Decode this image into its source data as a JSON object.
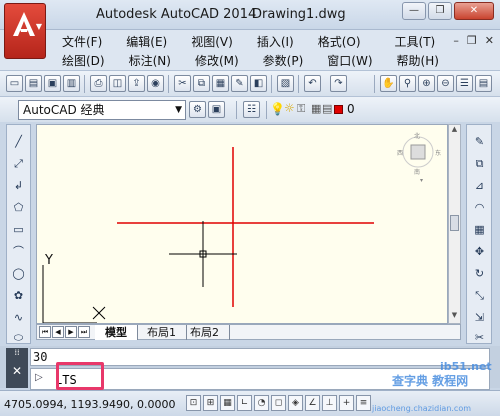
{
  "titlebar": {
    "app_title": "Autodesk AutoCAD 2014",
    "file_name": "Drawing1.dwg",
    "minimize": "—",
    "restore": "❒",
    "close": "✕"
  },
  "menu": {
    "row1": [
      "文件(F)",
      "编辑(E)",
      "视图(V)",
      "插入(I)",
      "格式(O)",
      "工具(T)"
    ],
    "row2": [
      "绘图(D)",
      "标注(N)",
      "修改(M)",
      "参数(P)",
      "窗口(W)",
      "帮助(H)"
    ],
    "mdi_min": "–",
    "mdi_restore": "❒",
    "mdi_close": "✕"
  },
  "workspace": {
    "selected": "AutoCAD 经典"
  },
  "layer": {
    "name": "0",
    "color": "#e00000"
  },
  "viewcube": {
    "north": "北",
    "south": "南",
    "east": "东",
    "west": "西"
  },
  "ucs": {
    "x_label": "X",
    "y_label": "Y"
  },
  "layout_tabs": {
    "tabs": [
      "模型",
      "布局1",
      "布局2"
    ],
    "active": 0
  },
  "command": {
    "history": "30",
    "input_value": "LTS"
  },
  "status": {
    "coordinates": "4705.0994, 1193.9490, 0.0000"
  },
  "watermark": {
    "text": "查字典 教程网",
    "url": "jiaocheng.chazidian.com",
    "site": "ib51.net"
  },
  "colors": {
    "canvas_bg": "#fffeee",
    "crosshair": "#e00000",
    "cursor": "#000000",
    "highlight_box": "#e8386a"
  }
}
